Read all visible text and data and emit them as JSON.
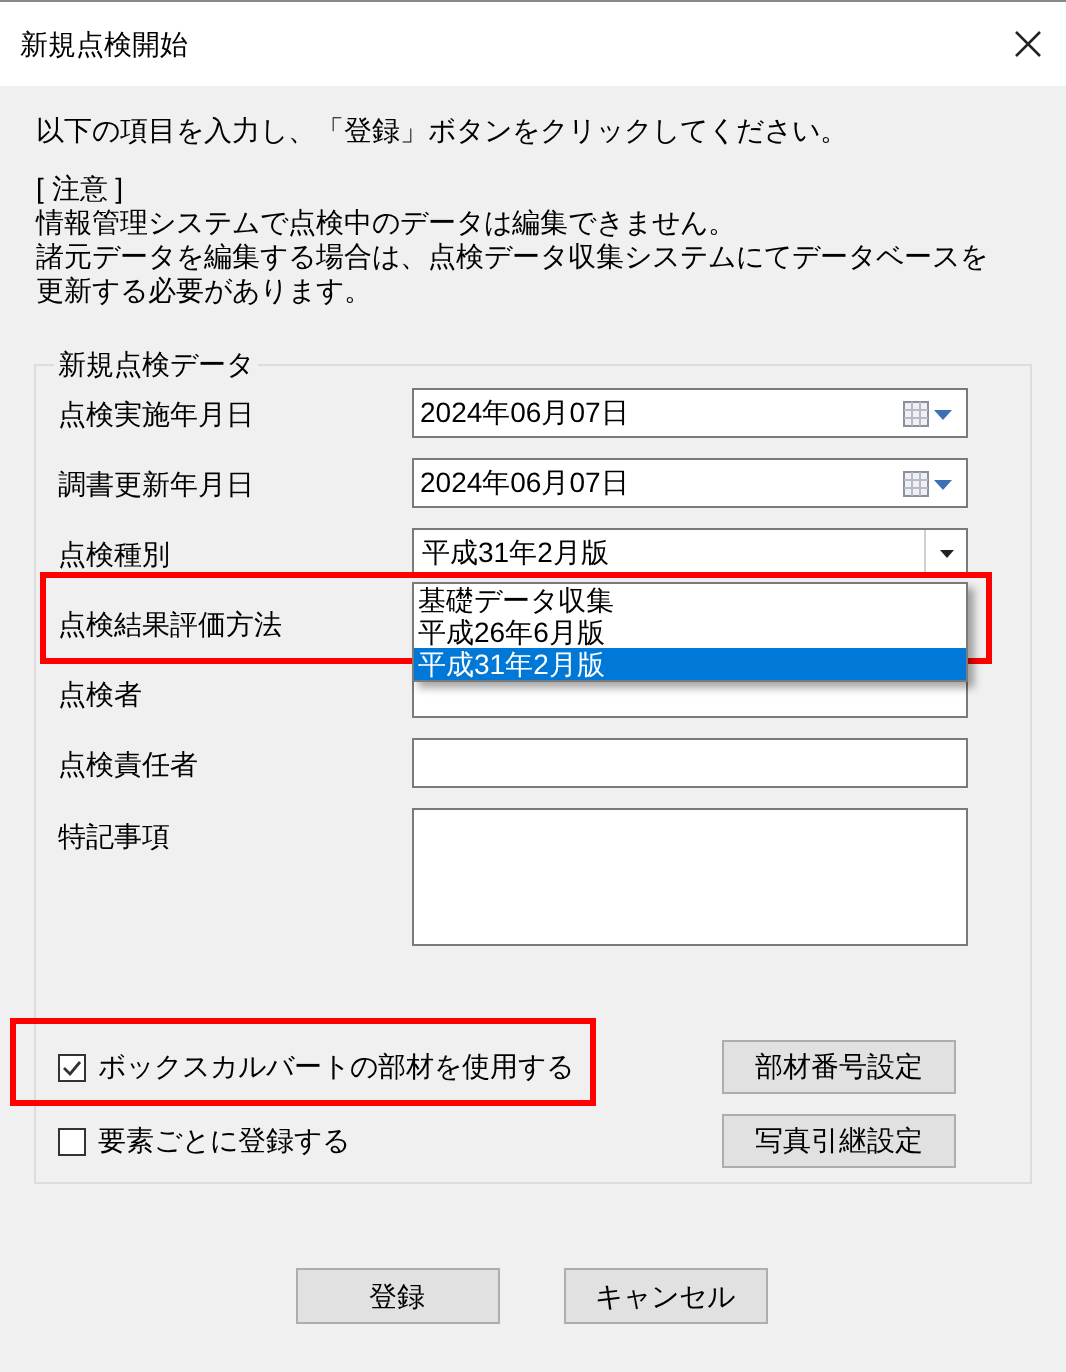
{
  "window": {
    "title": "新規点検開始"
  },
  "instructions": "以下の項目を入力し、「登録」ボタンをクリックしてください。",
  "notice": {
    "heading": "[ 注意 ]",
    "lines": [
      "情報管理システムで点検中のデータは編集できません。",
      "諸元データを編集する場合は、点検データ収集システムにてデータベースを",
      "更新する必要があります。"
    ]
  },
  "group": {
    "title": "新規点検データ",
    "fields": [
      {
        "kind": "date",
        "label": "点検実施年月日",
        "value": "2024年06月07日"
      },
      {
        "kind": "date",
        "label": "調書更新年月日",
        "value": "2024年06月07日"
      },
      {
        "kind": "combo",
        "label": "点検種別",
        "value": "平成31年2月版",
        "expanded": true,
        "options": [
          {
            "label": "基礎データ収集",
            "selected": false
          },
          {
            "label": "平成26年6月版",
            "selected": false
          },
          {
            "label": "平成31年2月版",
            "selected": true
          }
        ]
      },
      {
        "kind": "text",
        "label": "点検結果評価方法"
      },
      {
        "kind": "text",
        "label": "点検者"
      },
      {
        "kind": "text",
        "label": "点検責任者"
      },
      {
        "kind": "memo",
        "label": "特記事項"
      }
    ],
    "options": [
      {
        "label": "ボックスカルバートの部材を使用する",
        "checked": true
      },
      {
        "label": "要素ごとに登録する",
        "checked": false
      }
    ],
    "side_buttons": [
      "部材番号設定",
      "写真引継設定"
    ]
  },
  "buttons": [
    "登録",
    "キャンセル"
  ]
}
